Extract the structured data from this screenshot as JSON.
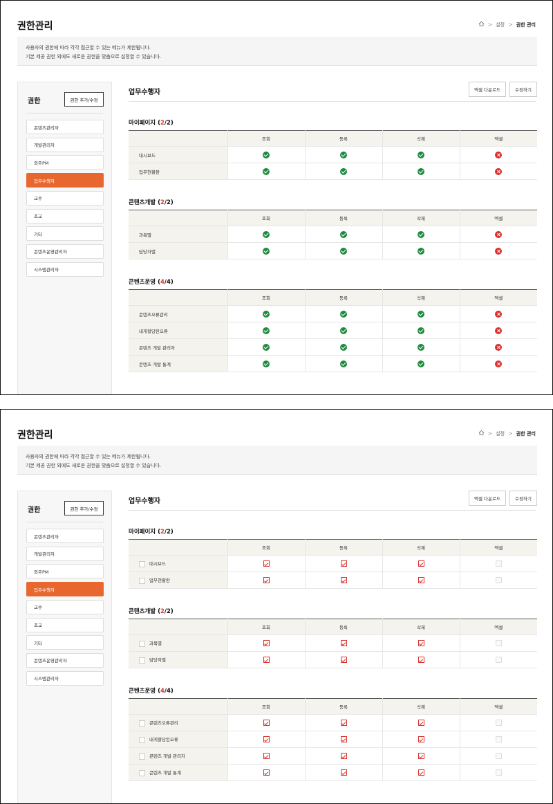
{
  "page_title": "권한관리",
  "breadcrumb": {
    "home_icon": "home-icon",
    "level1": "설정",
    "current": "권한 관리",
    "separator": ">"
  },
  "info": {
    "line1": "사용자의 권한에 따라 각각 접근할 수 있는 메뉴가 제한됩니다.",
    "line2": "기본 제공 권한 외에도 새로운 권한을 맞춤으로 설정할 수 있습니다."
  },
  "sidebar": {
    "title": "권한",
    "add_button": "권한 추가/수정",
    "items": [
      "콘텐츠관리자",
      "개발관리자",
      "외주PM",
      "업무수행자",
      "교수",
      "조교",
      "기타",
      "콘텐츠운영관리자",
      "시스템관리자"
    ],
    "active_index": 3
  },
  "main": {
    "title": "업무수행자",
    "excel_button": "엑셀 다운로드",
    "edit_button": "수정하기",
    "columns": [
      "조회",
      "등록",
      "삭제",
      "엑셀"
    ],
    "colors": {
      "accent": "#e8672f",
      "ok": "#1d8a3f",
      "no": "#d9302b"
    },
    "groups": [
      {
        "name": "마이페이지",
        "count_open": " (",
        "count_a": "2",
        "count_slash": "/",
        "count_b": "2",
        "count_close": ")",
        "rows": [
          {
            "label": "대시보드",
            "perms": [
              true,
              true,
              true,
              false
            ]
          },
          {
            "label": "업무현황판",
            "perms": [
              true,
              true,
              true,
              false
            ]
          }
        ]
      },
      {
        "name": "콘텐츠개발",
        "count_open": " (",
        "count_a": "2",
        "count_slash": "/",
        "count_b": "2",
        "count_close": ")",
        "rows": [
          {
            "label": "과목별",
            "perms": [
              true,
              true,
              true,
              false
            ]
          },
          {
            "label": "담당자별",
            "perms": [
              true,
              true,
              true,
              false
            ]
          }
        ]
      },
      {
        "name": "콘텐츠운영",
        "count_open": " (",
        "count_a": "4",
        "count_slash": "/",
        "count_b": "4",
        "count_close": ")",
        "rows": [
          {
            "label": "콘텐츠오류관리",
            "perms": [
              true,
              true,
              true,
              false
            ]
          },
          {
            "label": "내게할당된오류",
            "perms": [
              true,
              true,
              true,
              false
            ]
          },
          {
            "label": "콘텐츠 개발 관리자",
            "perms": [
              true,
              true,
              true,
              false
            ]
          },
          {
            "label": "콘텐츠 개발 통계",
            "perms": [
              true,
              true,
              true,
              false
            ]
          }
        ]
      }
    ]
  }
}
